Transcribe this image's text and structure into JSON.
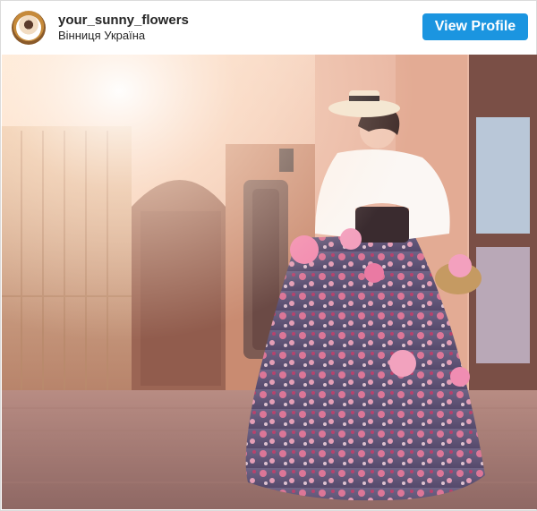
{
  "post": {
    "username": "your_sunny_flowers",
    "location": "Вінниця Україна",
    "view_profile_label": "View Profile"
  },
  "icons": {
    "avatar": "profile-photo"
  },
  "colors": {
    "button": "#1b95e0",
    "text": "#262626",
    "border": "#dbdbdb"
  }
}
